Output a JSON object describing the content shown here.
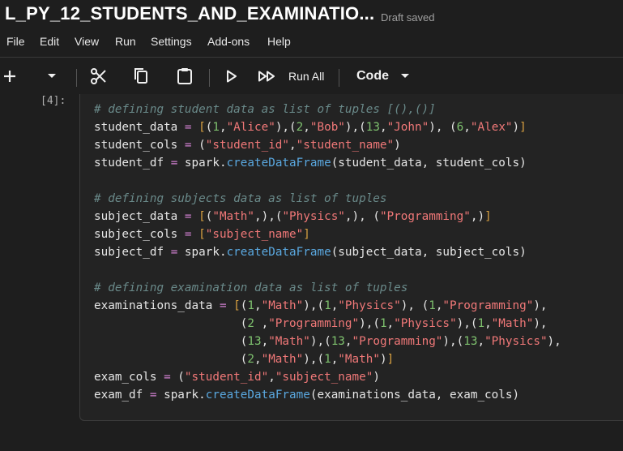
{
  "window": {
    "title": "L_PY_12_STUDENTS_AND_EXAMINATIO...",
    "status": "Draft saved"
  },
  "menu": [
    "File",
    "Edit",
    "View",
    "Run",
    "Settings",
    "Add-ons",
    "Help"
  ],
  "toolbar": {
    "run_all_label": "Run All",
    "cell_type_label": "Code",
    "icons": [
      "plus-icon",
      "chevron-down-icon",
      "scissors-icon",
      "copy-icon",
      "clipboard-icon",
      "play-icon",
      "fast-forward-icon",
      "chevron-down-icon"
    ]
  },
  "cell": {
    "execution_count": "[4]:",
    "code_lines": [
      "# defining student data as list of tuples [(),()]",
      "student_data = [(1,\"Alice\"),(2,\"Bob\"),(13,\"John\"), (6,\"Alex\")]",
      "student_cols = (\"student_id\",\"student_name\")",
      "student_df = spark.createDataFrame(student_data, student_cols)",
      "",
      "# defining subjects data as list of tuples",
      "subject_data = [(\"Math\",),(\"Physics\",), (\"Programming\",)]",
      "subject_cols = [\"subject_name\"]",
      "subject_df = spark.createDataFrame(subject_data, subject_cols)",
      "",
      "# defining examination data as list of tuples",
      "examinations_data = [(1,\"Math\"),(1,\"Physics\"), (1,\"Programming\"),",
      "                     (2 ,\"Programming\"),(1,\"Physics\"),(1,\"Math\"),",
      "                     (13,\"Math\"),(13,\"Programming\"),(13,\"Physics\"),",
      "                     (2,\"Math\"),(1,\"Math\")]",
      "exam_cols = (\"student_id\",\"subject_name\")",
      "exam_df = spark.createDataFrame(examinations_data, exam_cols)"
    ]
  },
  "colors": {
    "background": "#1e1e1e",
    "comment": "#6a8a8a",
    "string": "#f07878",
    "number": "#7ec16e",
    "function": "#5aa8e0",
    "operator": "#d080d0",
    "bracket": "#d8a040"
  }
}
